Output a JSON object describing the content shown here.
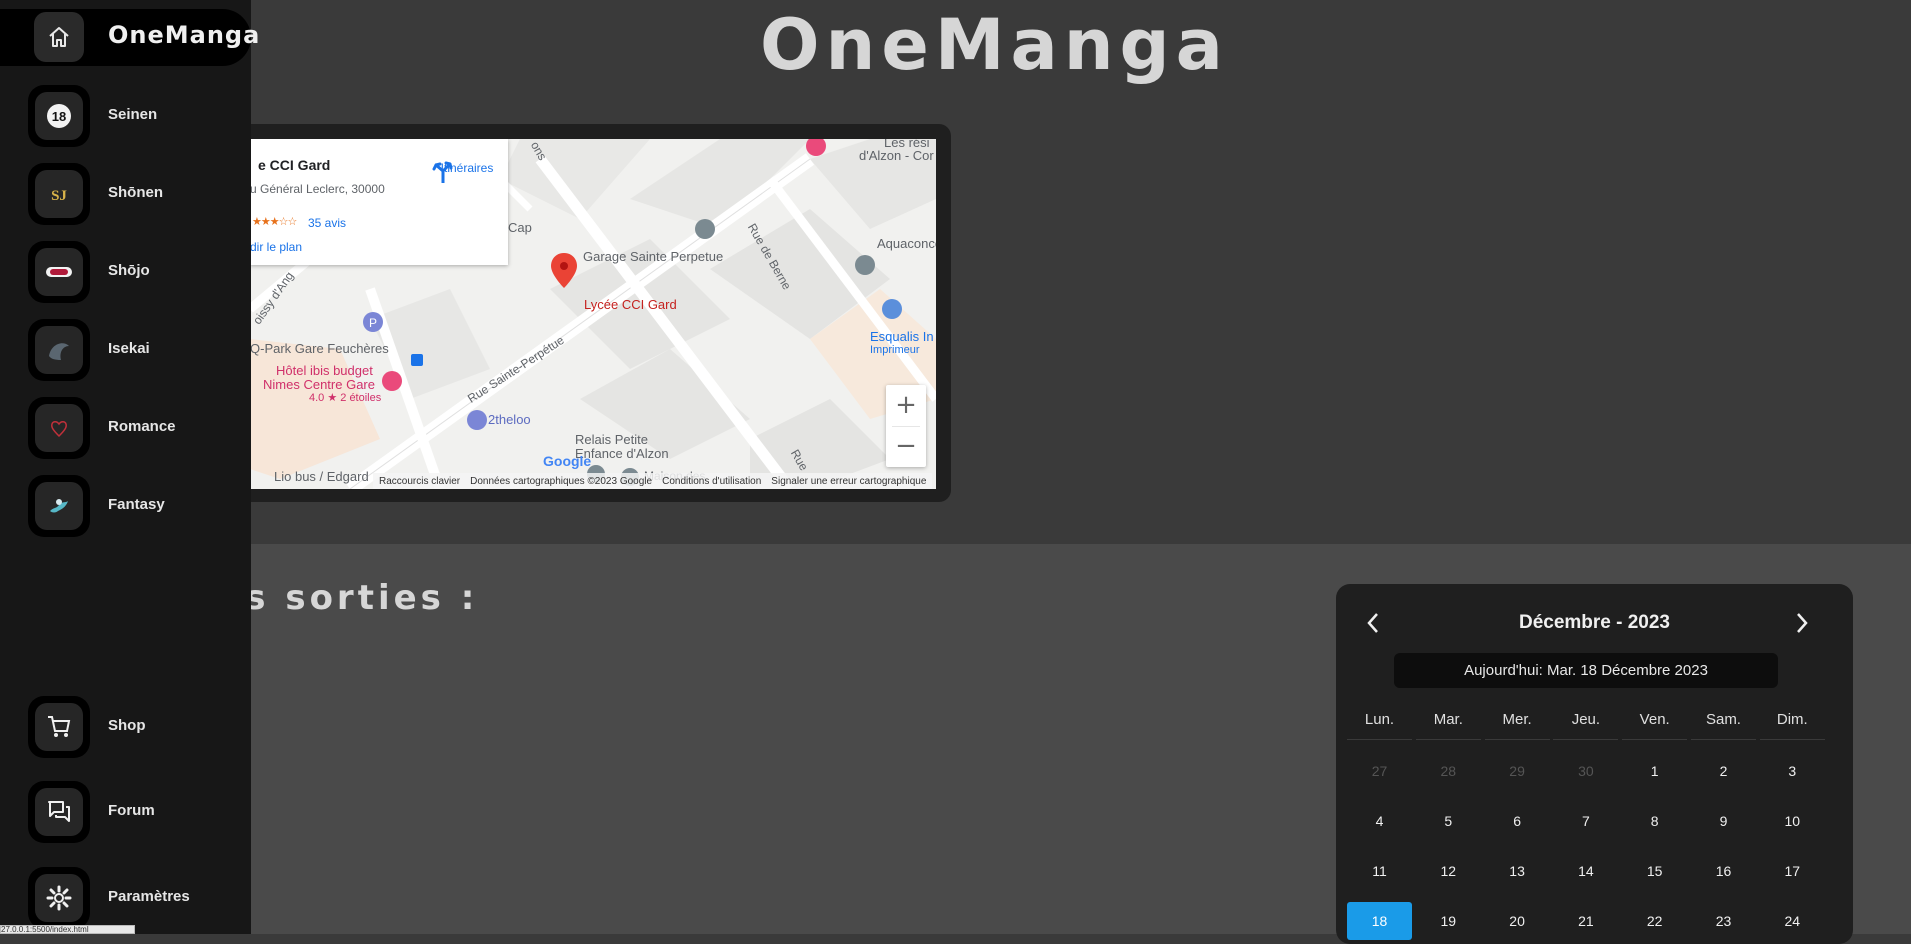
{
  "app": {
    "title": "OneManga"
  },
  "sidebar": {
    "brand": "OneManga",
    "items": [
      {
        "label": "Seinen",
        "icon": "age-18-icon"
      },
      {
        "label": "Shōnen",
        "icon": "shonen-jump-icon"
      },
      {
        "label": "Shōjo",
        "icon": "shojo-icon"
      },
      {
        "label": "Isekai",
        "icon": "isekai-icon"
      },
      {
        "label": "Romance",
        "icon": "heart-icon"
      },
      {
        "label": "Fantasy",
        "icon": "fantasy-icon"
      }
    ],
    "bottom_items": [
      {
        "label": "Shop",
        "icon": "cart-icon"
      },
      {
        "label": "Forum",
        "icon": "forum-icon"
      },
      {
        "label": "Paramètres",
        "icon": "gear-icon"
      }
    ]
  },
  "map": {
    "card": {
      "name": "e CCI Gard",
      "address": "u Général Leclerc, 30000",
      "reviews": "35 avis",
      "bigmap": "dir le plan",
      "directions": "Itinéraires"
    },
    "labels": {
      "lycee": "Lycée CCI Gard",
      "garage": "Garage Sainte Perpetue",
      "aquaconcepts": "Aquaconcepts",
      "rue_berne": "Rue de Berne",
      "esqualis": "Esqualis In",
      "imprimeur": "Imprimeur",
      "qpark": "Q-Park Gare Feuchères",
      "ibis1": "Hôtel ibis budget",
      "ibis2": "Nimes Centre Gare",
      "ibis_rating": "4.0 ★ 2 étoiles",
      "rue_sainte": "Rue Sainte-Perpétue",
      "theloo": "2theloo",
      "relais1": "Relais Petite",
      "relais2": "Enfance d'Alzon",
      "cap": "Cap",
      "les_resi": "Les rési",
      "dalzon": "d'Alzon - Cor",
      "boissy": "oissy d'Ang",
      "lio_bus": "Lio bus / Edgard",
      "maison": "Maison des",
      "ons": "ons",
      "rue": "Rue",
      "google": "Google"
    },
    "footer": {
      "shortcuts": "Raccourcis clavier",
      "data": "Données cartographiques ©2023 Google",
      "terms": "Conditions d'utilisation",
      "report": "Signaler une erreur cartographique"
    }
  },
  "releases": {
    "title": "hes sorties :"
  },
  "calendar": {
    "month": "Décembre - 2023",
    "today": "Aujourd'hui: Mar. 18 Décembre 2023",
    "weekdays": [
      "Lun.",
      "Mar.",
      "Mer.",
      "Jeu.",
      "Ven.",
      "Sam.",
      "Dim."
    ],
    "weeks": [
      [
        "27",
        "28",
        "29",
        "30",
        "1",
        "2",
        "3"
      ],
      [
        "4",
        "5",
        "6",
        "7",
        "8",
        "9",
        "10"
      ],
      [
        "11",
        "12",
        "13",
        "14",
        "15",
        "16",
        "17"
      ],
      [
        "18",
        "19",
        "20",
        "21",
        "22",
        "23",
        "24"
      ]
    ],
    "muted_first_week": 4,
    "selected": "18",
    "accent": "#1a9be8"
  },
  "status_url": "27.0.0.1:5500/index.html"
}
